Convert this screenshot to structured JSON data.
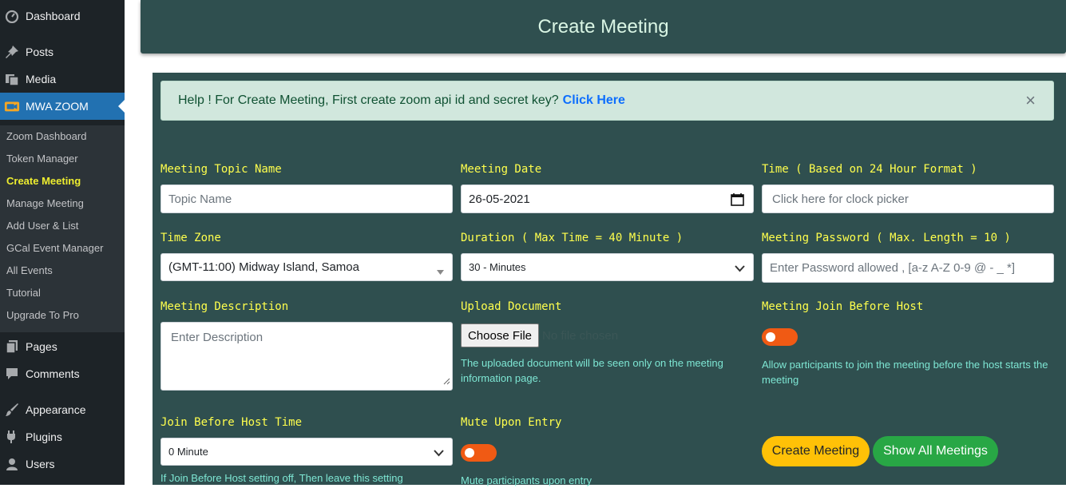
{
  "sidebar": {
    "items": [
      {
        "label": "Dashboard",
        "icon": "dashboard-icon"
      },
      {
        "label": "Posts",
        "icon": "pin-icon"
      },
      {
        "label": "Media",
        "icon": "media-icon"
      },
      {
        "label": "MWA ZOOM",
        "icon": "zoom-camera-icon"
      },
      {
        "label": "Pages",
        "icon": "pages-icon"
      },
      {
        "label": "Comments",
        "icon": "comment-icon"
      },
      {
        "label": "Appearance",
        "icon": "brush-icon"
      },
      {
        "label": "Plugins",
        "icon": "plugin-icon"
      },
      {
        "label": "Users",
        "icon": "user-icon"
      }
    ],
    "submenu": [
      "Zoom Dashboard",
      "Token Manager",
      "Create Meeting",
      "Manage Meeting",
      "Add User & List",
      "GCal Event Manager",
      "All Events",
      "Tutorial",
      "Upgrade To Pro"
    ],
    "active_color": "#2271b1",
    "current_sub_color": "#eded2f"
  },
  "header": {
    "title": "Create Meeting"
  },
  "alert": {
    "text": "Help ! For Create Meeting, First create zoom api id and secret key?",
    "link": "Click Here",
    "close": "×"
  },
  "form": {
    "topic_label": "Meeting Topic Name",
    "topic_placeholder": "Topic Name",
    "date_label": "Meeting Date",
    "date_value": "26-05-2021",
    "time_label": "Time ( Based on 24 Hour Format )",
    "time_placeholder": "Click here for clock picker",
    "timezone_label": "Time Zone",
    "timezone_value": "(GMT-11:00) Midway Island, Samoa",
    "duration_label": "Duration ( Max Time = 40 Minute )",
    "duration_value": "30 - Minutes",
    "password_label": "Meeting Password ( Max. Length = 10 )",
    "password_placeholder": "Enter Password allowed , [a-z A-Z 0-9 @ - _ *]",
    "description_label": "Meeting Description",
    "description_placeholder": "Enter Description",
    "upload_label": "Upload Document",
    "choose_file": "Choose File",
    "no_file": "No file chosen",
    "upload_help_1": "The uploaded document will be seen only on the meeting",
    "upload_help_2": "information page.",
    "jbh_label": "Meeting Join Before Host",
    "jbh_help_1": "Allow participants to join the meeting before the host starts the",
    "jbh_help_2": "meeting",
    "jbh_time_label": "Join Before Host Time",
    "jbh_time_value": "0 Minute",
    "jbh_time_help": "If Join Before Host setting off, Then leave this setting",
    "mute_label": "Mute Upon Entry",
    "mute_help": "Mute participants upon entry",
    "create_button": "Create Meeting",
    "show_all_button": "Show All Meetings"
  },
  "colors": {
    "panel": "#2f4f4f",
    "label": "#ffff4d",
    "help": "#7ee7d4",
    "toggle": "#f05a14",
    "create_button": "#ffc107",
    "show_all_button": "#28a745"
  }
}
